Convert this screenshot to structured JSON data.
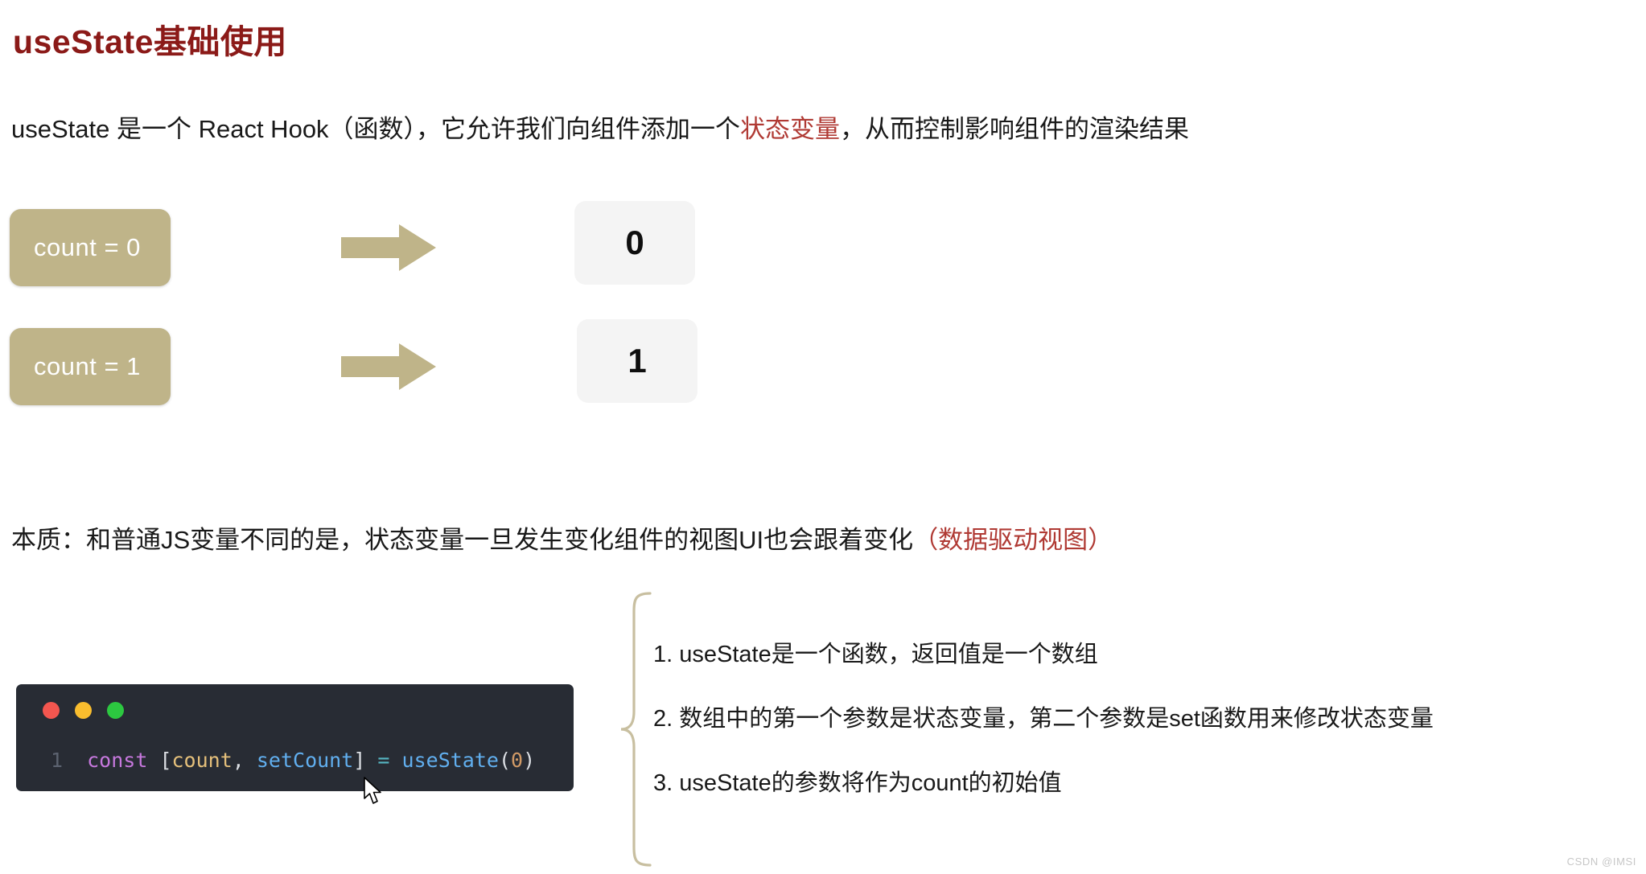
{
  "page": {
    "title": "useState基础使用",
    "title_color": "#8b1a18",
    "background": "#ffffff"
  },
  "intro": {
    "before_highlight": "useState 是一个 React Hook（函数），它允许我们向组件添加一个",
    "highlight": "状态变量",
    "after_highlight": "，从而控制影响组件的渲染结果",
    "highlight_color": "#b03a34"
  },
  "diagram": {
    "box_color": "#bfb489",
    "result_box_color": "#f4f4f4",
    "arrow_color": "#bfb489",
    "rows": [
      {
        "state_label": "count = 0",
        "result_value": "0"
      },
      {
        "state_label": "count = 1",
        "result_value": "1"
      }
    ]
  },
  "essence": {
    "black_text": "本质：和普通JS变量不同的是，状态变量一旦发生变化组件的视图UI也会跟着变化",
    "red_text": "（数据驱动视图）",
    "red_color": "#b03a34"
  },
  "code": {
    "window_background": "#282c34",
    "dots": [
      "red",
      "yellow",
      "green"
    ],
    "line_number": "1",
    "tokens": [
      {
        "text": "const",
        "type": "keyword"
      },
      {
        "text": " ",
        "type": "plain"
      },
      {
        "text": "[",
        "type": "punct"
      },
      {
        "text": "count",
        "type": "var"
      },
      {
        "text": ", ",
        "type": "punct"
      },
      {
        "text": "setCount",
        "type": "fnvar"
      },
      {
        "text": "]",
        "type": "punct"
      },
      {
        "text": " ",
        "type": "plain"
      },
      {
        "text": "=",
        "type": "op"
      },
      {
        "text": " ",
        "type": "plain"
      },
      {
        "text": "useState",
        "type": "fn"
      },
      {
        "text": "(",
        "type": "punct"
      },
      {
        "text": "0",
        "type": "num"
      },
      {
        "text": ")",
        "type": "punct"
      }
    ],
    "full_line": "const [count, setCount] = useState(0)"
  },
  "notes": {
    "items": [
      "1. useState是一个函数，返回值是一个数组",
      "2. 数组中的第一个参数是状态变量，第二个参数是set函数用来修改状态变量",
      "3. useState的参数将作为count的初始值"
    ]
  },
  "watermark": {
    "text": "CSDN @IMSI"
  }
}
